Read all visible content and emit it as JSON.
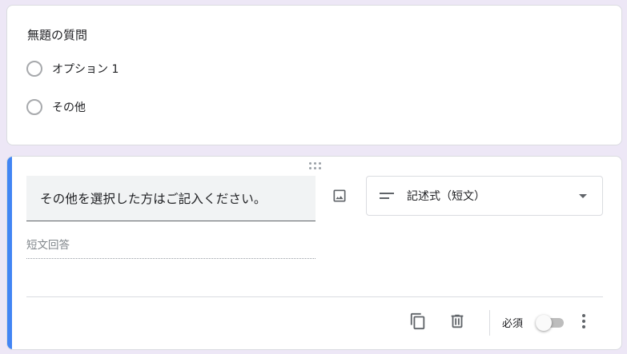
{
  "question_card_1": {
    "title": "無題の質問",
    "options": [
      {
        "label": "オプション 1"
      },
      {
        "label": "その他"
      }
    ]
  },
  "question_card_2": {
    "question_text": "その他を選択した方はご記入ください。",
    "type_select": {
      "selected": "記述式（短文）",
      "icon": "short-answer-icon"
    },
    "answer_placeholder": "短文回答",
    "footer": {
      "copy_icon": "content-copy-icon",
      "delete_icon": "trash-icon",
      "required_label": "必須",
      "required_on": false,
      "more_icon": "more-vert-icon"
    }
  },
  "colors": {
    "background": "#ede7f6",
    "accent": "#4285f4",
    "icon": "#5f6368"
  }
}
